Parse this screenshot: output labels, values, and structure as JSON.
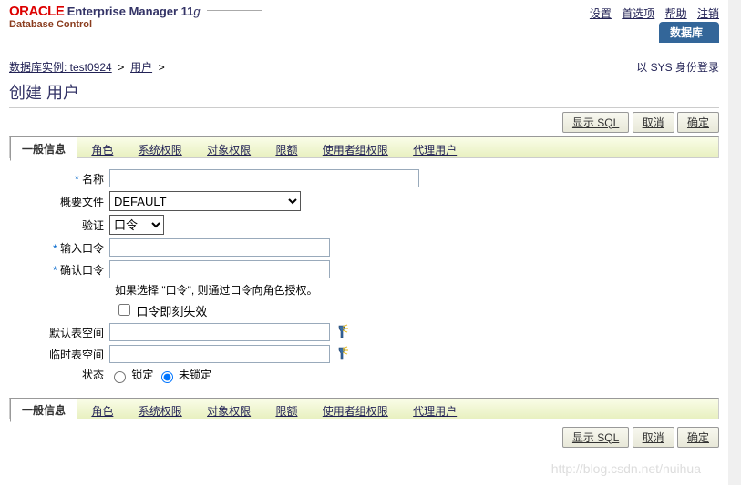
{
  "header": {
    "oracle": "ORACLE",
    "product": "Enterprise Manager 11",
    "g": "g",
    "sub": "Database Control",
    "links": {
      "settings": "设置",
      "prefs": "首选项",
      "help": "帮助",
      "logout": "注销"
    },
    "db_tab": "数据库"
  },
  "breadcrumb": {
    "instance_link": "数据库实例: test0924",
    "users_link": "用户",
    "login_as_prefix": "以 ",
    "login_as_user": "SYS",
    "login_as_suffix": " 身份登录"
  },
  "page_title": "创建 用户",
  "buttons": {
    "show_sql": "显示 SQL",
    "cancel": "取消",
    "ok": "确定"
  },
  "tabs": {
    "general": "一般信息",
    "roles": "角色",
    "sys_priv": "系统权限",
    "obj_priv": "对象权限",
    "quota": "限额",
    "consumer": "使用者组权限",
    "proxy": "代理用户"
  },
  "form": {
    "name_label": "名称",
    "name_value": "",
    "profile_label": "概要文件",
    "profile_value": "DEFAULT",
    "auth_label": "验证",
    "auth_value": "口令",
    "enter_pw_label": "输入口令",
    "enter_pw_value": "",
    "confirm_pw_label": "确认口令",
    "confirm_pw_value": "",
    "pw_hint": "如果选择 \"口令\", 则通过口令向角色授权。",
    "expire_label": "口令即刻失效",
    "default_ts_label": "默认表空间",
    "default_ts_value": "",
    "temp_ts_label": "临时表空间",
    "temp_ts_value": "",
    "status_label": "状态",
    "status_locked": "锁定",
    "status_unlocked": "未锁定"
  },
  "watermark": "http://blog.csdn.net/nuihua"
}
